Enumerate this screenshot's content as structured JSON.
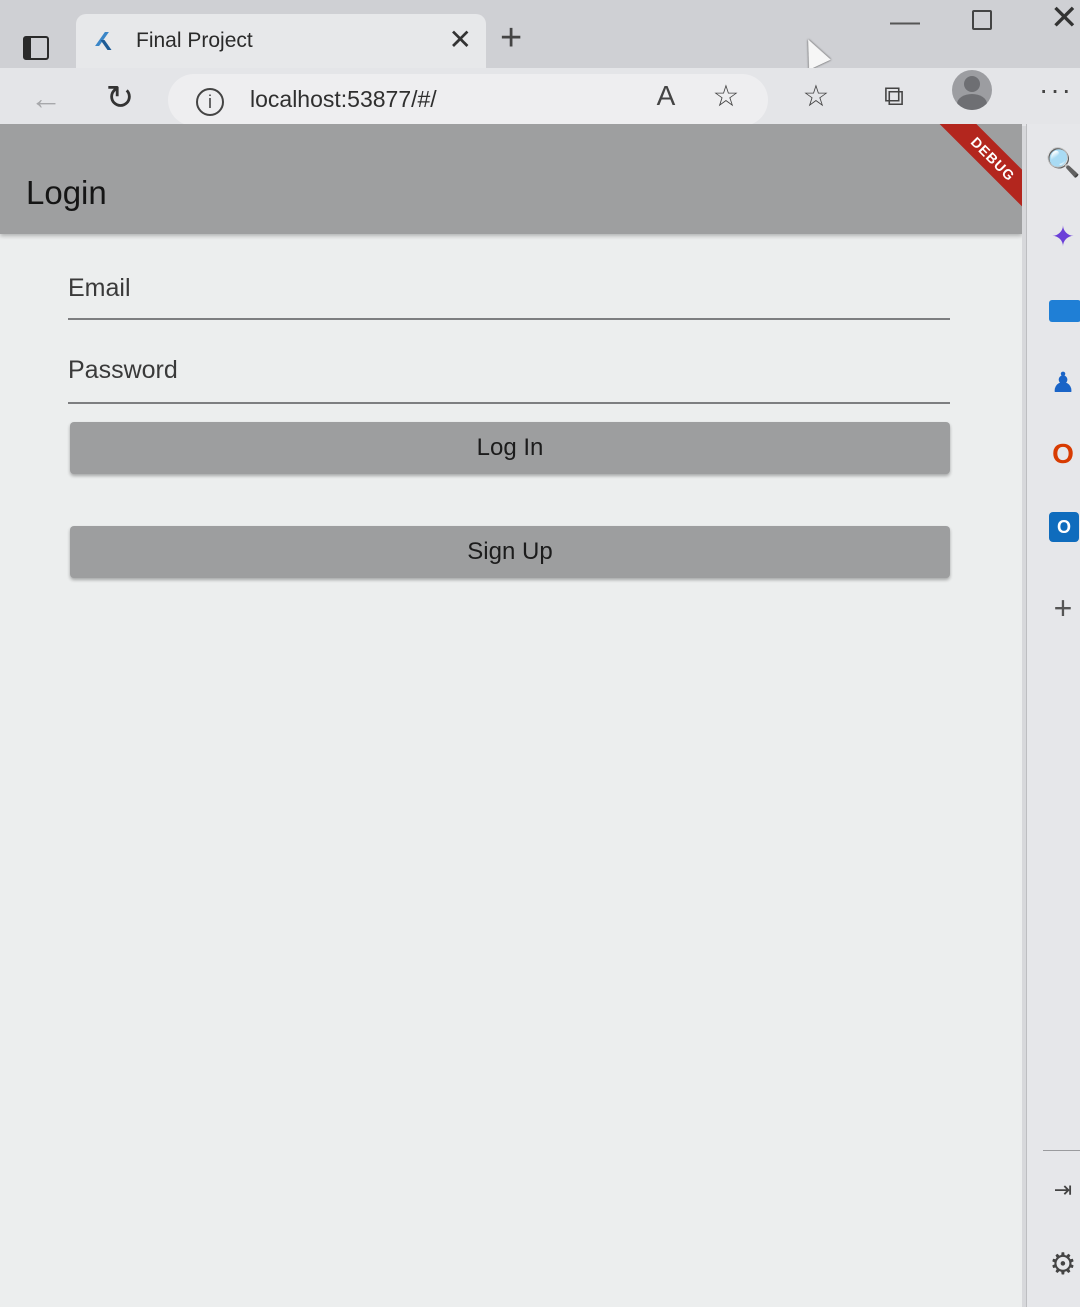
{
  "browser": {
    "tab": {
      "title": "Final Project",
      "close_glyph": "✕"
    },
    "new_tab_glyph": "+",
    "window_controls": {
      "minimize": "—",
      "maximize": "",
      "close": "✕"
    },
    "toolbar": {
      "back_glyph": "←",
      "reload_glyph": "↻",
      "info_glyph": "i",
      "url": "localhost:53877/#/",
      "read_aloud_glyph": "A",
      "add_favorite_glyph": "☆",
      "favorites_glyph": "☆",
      "collections_glyph": "⧉",
      "more_glyph": "···"
    }
  },
  "app": {
    "appbar": {
      "title": "Login",
      "debug_banner": "DEBUG"
    },
    "email": {
      "label": "Email"
    },
    "password": {
      "label": "Password"
    },
    "login_button": "Log In",
    "signup_button": "Sign Up"
  },
  "sidebar": {
    "search_glyph": "🔍",
    "copilot_glyph": "✦",
    "games_glyph": "♟",
    "office_glyph": "O",
    "outlook_glyph": "O",
    "add_glyph": "+",
    "hide_glyph": "⇥",
    "settings_glyph": "⚙"
  },
  "colors": {
    "appbar": "#9e9fa0",
    "button": "#9d9e9f",
    "debug_banner": "#b3261e",
    "page_background": "#eceeee"
  }
}
